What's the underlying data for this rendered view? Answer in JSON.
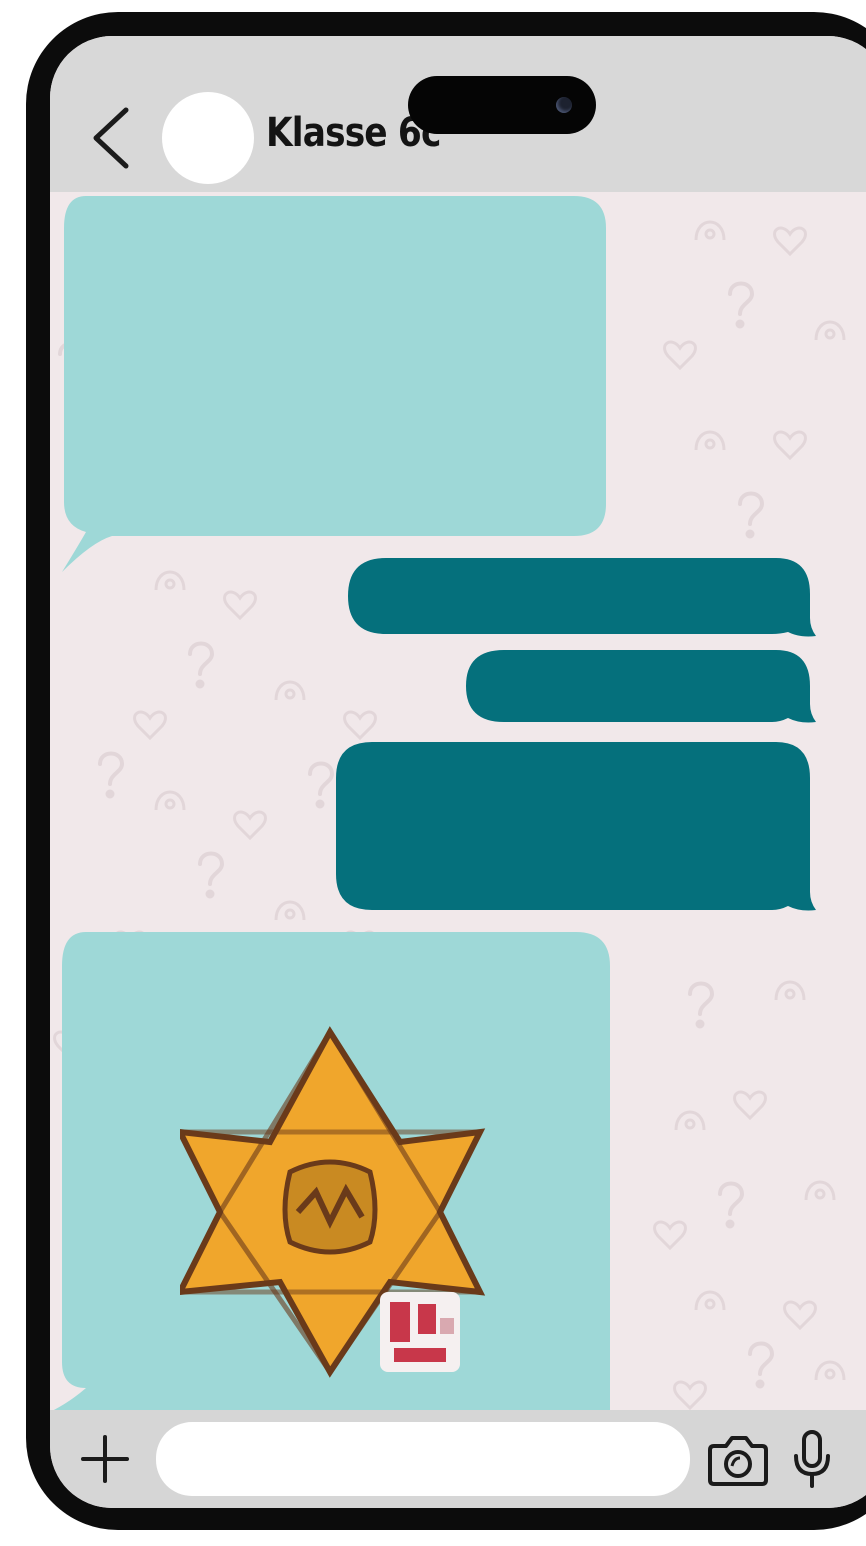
{
  "chat": {
    "title": "Klasse 6c"
  },
  "messages": [
    {
      "direction": "incoming",
      "kind": "text",
      "text": ""
    },
    {
      "direction": "outgoing",
      "kind": "text",
      "text": ""
    },
    {
      "direction": "outgoing",
      "kind": "text",
      "text": ""
    },
    {
      "direction": "outgoing",
      "kind": "text",
      "text": ""
    },
    {
      "direction": "incoming",
      "kind": "sticker",
      "sticker": "yellow-star-badge-sticker"
    }
  ],
  "composer": {
    "value": "",
    "placeholder": ""
  },
  "icons": {
    "back": "chevron-left-icon",
    "add": "plus-icon",
    "camera": "camera-icon",
    "mic": "microphone-icon"
  },
  "colors": {
    "incoming_bubble": "#9ed8d7",
    "outgoing_bubble": "#05707c",
    "chat_background": "#f1e8ea",
    "header_background": "#d8d8d8",
    "sticker_star": "#f0a62c"
  }
}
